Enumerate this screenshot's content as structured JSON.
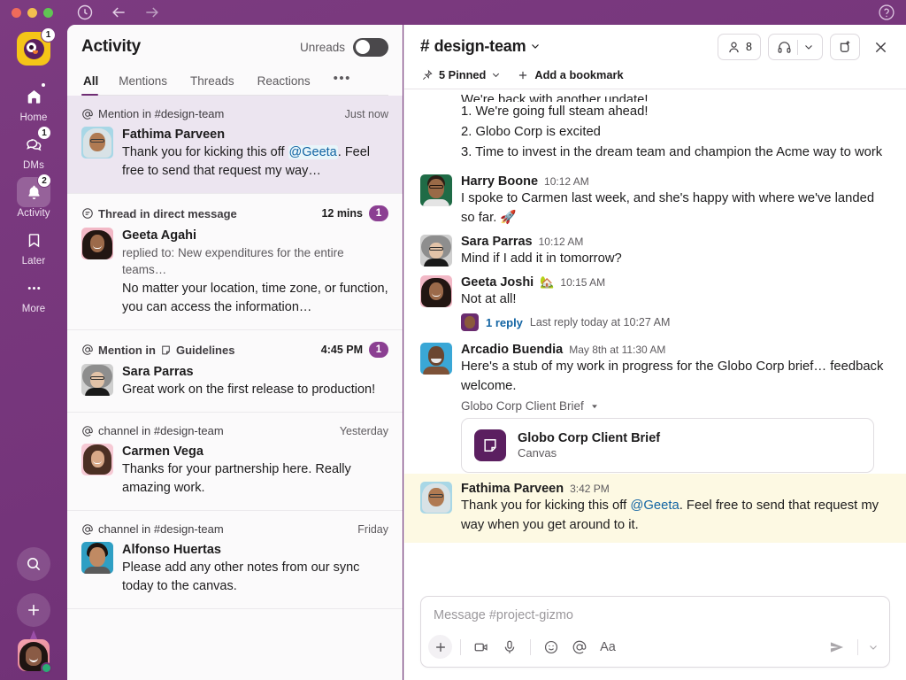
{
  "titlebar": {
    "history_icon": "clock-icon",
    "back_icon": "arrow-left-icon",
    "forward_icon": "arrow-right-icon",
    "help_icon": "help-circle-icon"
  },
  "rail": {
    "workspace": {
      "name": "workspace-logo",
      "badge": "1"
    },
    "items": [
      {
        "label": "Home",
        "icon": "home-icon",
        "badge": "",
        "dot": true,
        "active": false
      },
      {
        "label": "DMs",
        "icon": "messages-icon",
        "badge": "1",
        "dot": false,
        "active": false
      },
      {
        "label": "Activity",
        "icon": "bell-icon",
        "badge": "2",
        "dot": false,
        "active": true
      },
      {
        "label": "Later",
        "icon": "bookmark-icon",
        "badge": "",
        "dot": false,
        "active": false
      },
      {
        "label": "More",
        "icon": "ellipsis-icon",
        "badge": "",
        "dot": false,
        "active": false
      }
    ],
    "search_icon": "search-icon",
    "create_icon": "plus-icon",
    "avatar_name": "user-avatar",
    "presence": "active"
  },
  "activity": {
    "title": "Activity",
    "unreads_label": "Unreads",
    "unreads_on": false,
    "tabs": [
      {
        "label": "All",
        "active": true
      },
      {
        "label": "Mentions",
        "active": false
      },
      {
        "label": "Threads",
        "active": false
      },
      {
        "label": "Reactions",
        "active": false
      }
    ],
    "more_tab": "•••",
    "items": [
      {
        "kind_icon": "at-icon",
        "kind_text": "Mention in #design-team",
        "time": "Just now",
        "badge": "",
        "author": "Fathima Parveen",
        "subtitle": "",
        "text_before": "Thank you for kicking this off ",
        "mention": "@Geeta",
        "text_after": ". Feel free to send that request my way…",
        "highlight": true,
        "avatar": "fathima"
      },
      {
        "kind_icon": "thread-icon",
        "kind_text": "Thread in direct message",
        "time": "12 mins",
        "badge": "1",
        "author": "Geeta Agahi",
        "subtitle": "replied to: New expenditures for the entire teams…",
        "text_before": "No matter your location, time zone, or function, you can access the information…",
        "mention": "",
        "text_after": "",
        "highlight": false,
        "avatar": "geeta"
      },
      {
        "kind_icon": "at-icon",
        "kind_text": "Mention in",
        "kind_text2": "Guidelines",
        "kind_icon2": "canvas-icon",
        "time": "4:45 PM",
        "badge": "1",
        "author": "Sara Parras",
        "subtitle": "",
        "text_before": "Great work on the first release to production!",
        "mention": "",
        "text_after": "",
        "highlight": false,
        "avatar": "sara"
      },
      {
        "kind_icon": "at-icon",
        "kind_text": "channel in #design-team",
        "time": "Yesterday",
        "badge": "",
        "author": "Carmen Vega",
        "subtitle": "",
        "text_before": "Thanks for your partnership here. Really amazing work.",
        "mention": "",
        "text_after": "",
        "highlight": false,
        "avatar": "carmen"
      },
      {
        "kind_icon": "at-icon",
        "kind_text": "channel in #design-team",
        "time": "Friday",
        "badge": "",
        "author": "Alfonso Huertas",
        "subtitle": "",
        "text_before": "Please add any other notes from our sync today to the canvas.",
        "mention": "",
        "text_after": "",
        "highlight": false,
        "avatar": "alfonso"
      }
    ]
  },
  "channel": {
    "hash": "#",
    "name": "design-team",
    "members_count": "8",
    "members_icon": "person-icon",
    "huddle_icon": "headphones-icon",
    "huddle_caret": "chevron-down-icon",
    "split_icon": "open-in-new-icon",
    "close_icon": "close-icon",
    "bookmarks": {
      "pin_icon": "pin-icon",
      "pinned_label": "5 Pinned",
      "pinned_caret": "chevron-down-icon",
      "add_icon": "plus-icon",
      "add_label": "Add a bookmark"
    },
    "messages": [
      {
        "type": "clipped",
        "clipped_text": "We're back with another update!",
        "lines": [
          "1. We're going full steam ahead!",
          "2. Globo Corp is excited",
          "3. Time to invest in the dream team and champion the Acme way to work"
        ]
      },
      {
        "type": "message",
        "author": "Harry Boone",
        "time": "10:12 AM",
        "text": "I spoke to Carmen last week, and she's happy with where we've landed so far. 🚀",
        "avatar": "harry"
      },
      {
        "type": "message",
        "author": "Sara Parras",
        "time": "10:12 AM",
        "text": "Mind if I add it in tomorrow?",
        "avatar": "sara"
      },
      {
        "type": "message",
        "author": "Geeta Joshi",
        "author_emoji": "🏡",
        "time": "10:15 AM",
        "text": "Not at all!",
        "avatar": "geeta",
        "thread": {
          "link": "1 reply",
          "meta": "Last reply today at 10:27 AM",
          "avatar": "harry"
        }
      },
      {
        "type": "message",
        "author": "Arcadio Buendia",
        "time": "May 8th at 11:30 AM",
        "text": "Here's a stub of my work in progress for the Globo Corp brief… feedback welcome.",
        "avatar": "arcadio",
        "canvas": {
          "label": "Globo Corp Client Brief",
          "label_caret": "chevron-down-icon",
          "card_title": "Globo Corp Client Brief",
          "card_sub": "Canvas",
          "card_icon": "canvas-icon"
        }
      },
      {
        "type": "message",
        "author": "Fathima Parveen",
        "time": "3:42 PM",
        "text_before": "Thank you for kicking this off ",
        "mention": "@Geeta",
        "text_after": ". Feel free to send that request my way when you get around to it.",
        "avatar": "fathima",
        "highlight": true
      }
    ],
    "composer": {
      "placeholder": "Message #project-gizmo",
      "value": "",
      "tools": [
        {
          "icon": "plus-icon",
          "name": "add-attachment-button"
        },
        {
          "icon": "video-icon",
          "name": "video-clip-button"
        },
        {
          "icon": "mic-icon",
          "name": "audio-clip-button"
        },
        {
          "icon": "emoji-icon",
          "name": "emoji-button"
        },
        {
          "icon": "at-icon",
          "name": "mention-button"
        },
        {
          "icon": "format-text-icon",
          "name": "formatting-button",
          "text": "Aa"
        }
      ],
      "send_icon": "send-icon",
      "send_caret": "chevron-down-icon"
    }
  },
  "colors": {
    "brand_purple": "#7a3a7e",
    "accent_purple": "#8b3f92",
    "link_blue": "#1264a3",
    "mention_highlight": "#fdf9e3",
    "activity_highlight": "#ece5f0"
  }
}
